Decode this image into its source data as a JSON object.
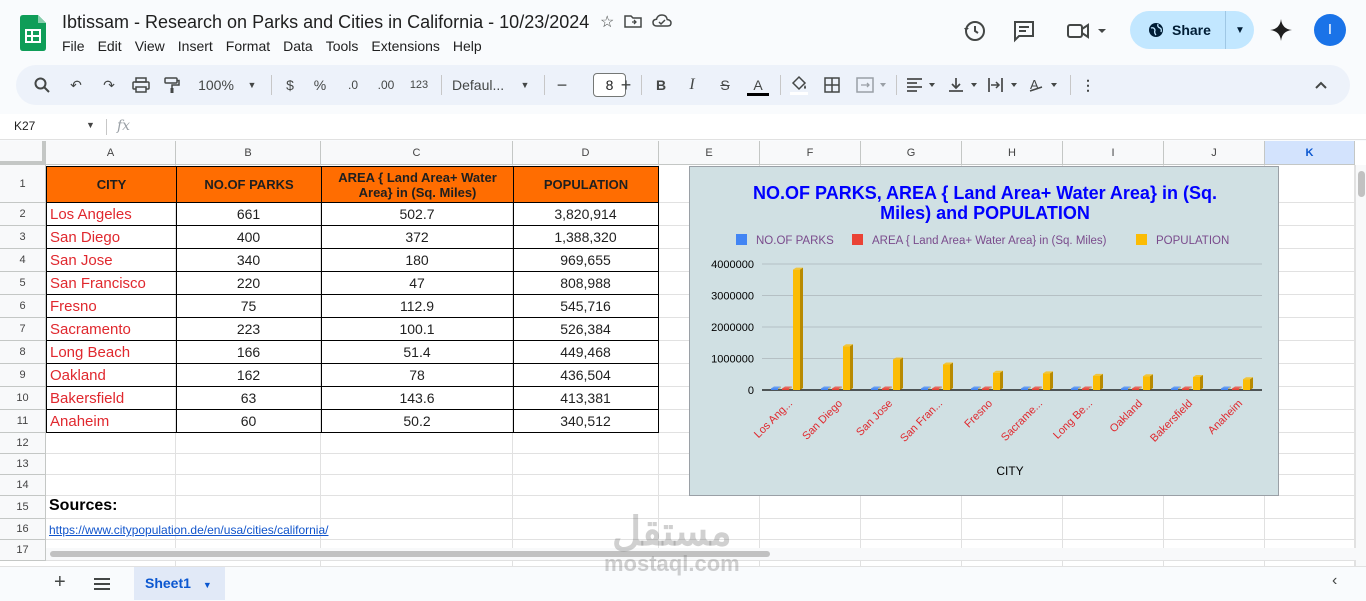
{
  "app": {
    "title": "Ibtissam - Research on Parks and Cities in California - 10/23/2024",
    "menu": [
      "File",
      "Edit",
      "View",
      "Insert",
      "Format",
      "Data",
      "Tools",
      "Extensions",
      "Help"
    ],
    "share_label": "Share",
    "avatar_initial": "I"
  },
  "toolbar": {
    "zoom": "100%",
    "currency": "$",
    "percent": "%",
    "dec_decrease": ".0",
    "dec_increase": ".00",
    "number_format": "123",
    "font": "Defaul...",
    "font_size": "8"
  },
  "formula_bar": {
    "name_box": "K27",
    "fx": "fx"
  },
  "columns": [
    "A",
    "B",
    "C",
    "D",
    "E",
    "F",
    "G",
    "H",
    "I",
    "J",
    "K"
  ],
  "rows": [
    "1",
    "2",
    "3",
    "4",
    "5",
    "6",
    "7",
    "8",
    "9",
    "10",
    "11",
    "12",
    "13",
    "14",
    "15",
    "16",
    "17"
  ],
  "table": {
    "headers": [
      "CITY",
      "NO.OF PARKS",
      "AREA { Land Area+ Water Area} in (Sq. Miles)",
      "POPULATION"
    ],
    "rows": [
      [
        "Los Angeles",
        "661",
        "502.7",
        "3,820,914"
      ],
      [
        "San Diego",
        "400",
        "372",
        "1,388,320"
      ],
      [
        "San Jose",
        "340",
        "180",
        "969,655"
      ],
      [
        "San Francisco",
        "220",
        "47",
        "808,988"
      ],
      [
        "Fresno",
        "75",
        "112.9",
        "545,716"
      ],
      [
        "Sacramento",
        "223",
        "100.1",
        "526,384"
      ],
      [
        "Long Beach",
        "166",
        "51.4",
        "449,468"
      ],
      [
        "Oakland",
        "162",
        "78",
        "436,504"
      ],
      [
        "Bakersfield",
        "63",
        "143.6",
        "413,381"
      ],
      [
        "Anaheim",
        "60",
        "50.2",
        "340,512"
      ]
    ]
  },
  "sources": {
    "label": "Sources:",
    "link1": "https://www.citypopulation.de/en/usa/cities/california/"
  },
  "sheet_tab": "Sheet1",
  "watermark": {
    "arabic": "مستقل",
    "latin": "mostaql.com"
  },
  "chart_data": {
    "type": "bar",
    "title": "NO.OF PARKS, AREA { Land Area+ Water Area} in (Sq. Miles) and POPULATION",
    "xlabel": "CITY",
    "ylabel": "",
    "categories": [
      "Los Ang...",
      "San Diego",
      "San Jose",
      "San Fran...",
      "Fresno",
      "Sacrame...",
      "Long Be...",
      "Oakland",
      "Bakersfield",
      "Anaheim"
    ],
    "series": [
      {
        "name": "NO.OF PARKS",
        "color": "#4285f4",
        "values": [
          661,
          400,
          340,
          220,
          75,
          223,
          166,
          162,
          63,
          60
        ]
      },
      {
        "name": "AREA { Land Area+ Water Area} in (Sq. Miles)",
        "color": "#ea4335",
        "values": [
          502.7,
          372,
          180,
          47,
          112.9,
          100.1,
          51.4,
          78,
          143.6,
          50.2
        ]
      },
      {
        "name": "POPULATION",
        "color": "#fbbc04",
        "values": [
          3820914,
          1388320,
          969655,
          808988,
          545716,
          526384,
          449468,
          436504,
          413381,
          340512
        ]
      }
    ],
    "yticks": [
      "0",
      "1000000",
      "2000000",
      "3000000",
      "4000000"
    ],
    "ylim": [
      0,
      4000000
    ],
    "legend": "top",
    "title_color": "#0000ff",
    "label_color": "#e0282e",
    "grid": true
  }
}
